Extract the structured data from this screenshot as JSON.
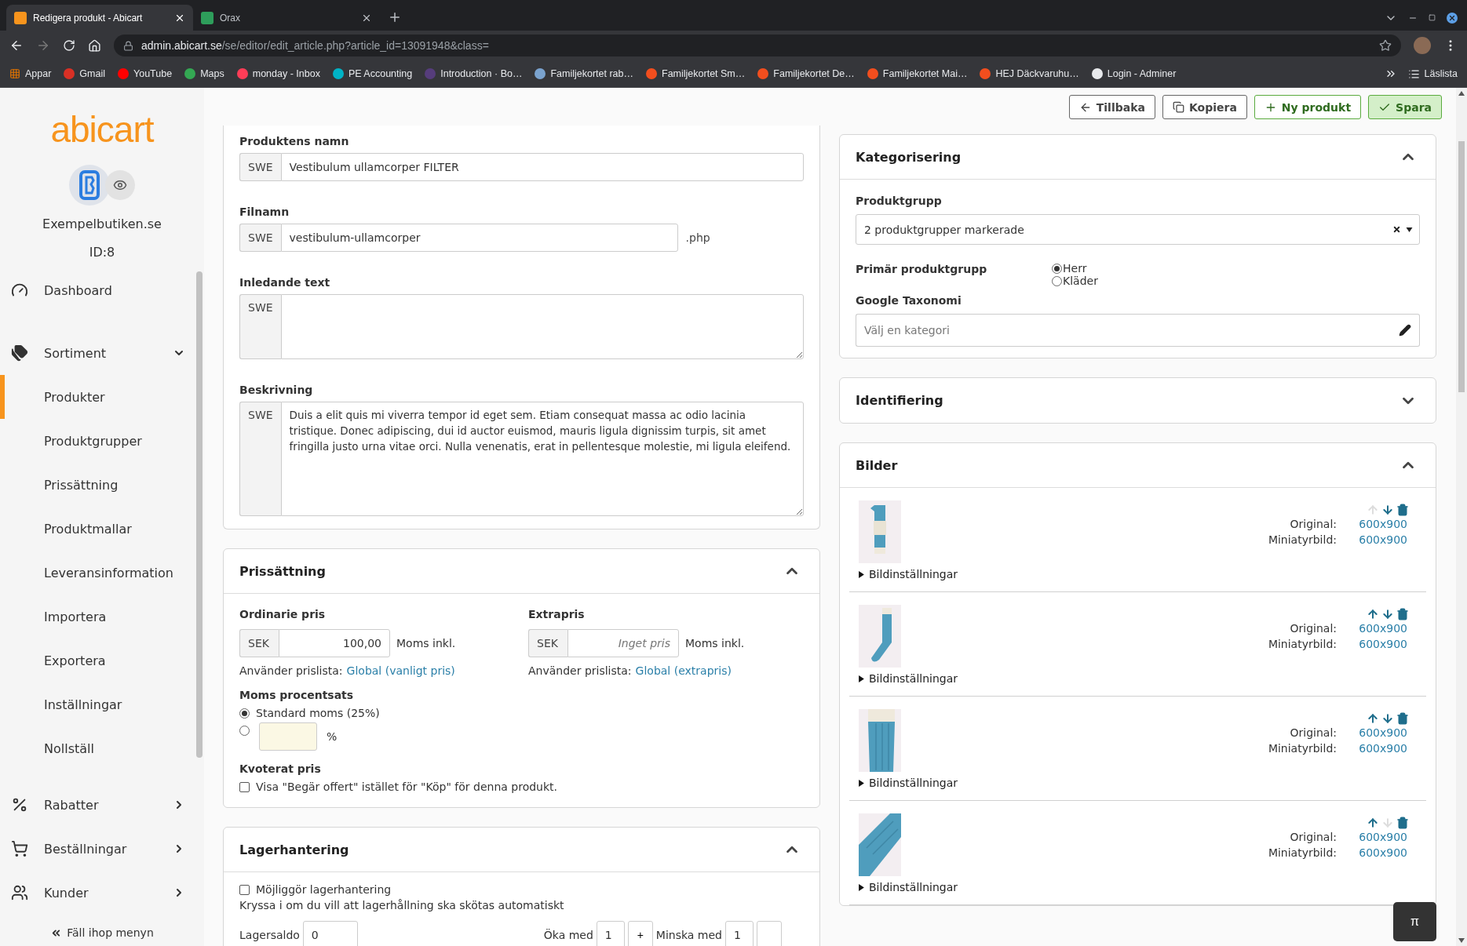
{
  "browser": {
    "tabs": [
      {
        "title": "Redigera produkt - Abicart",
        "selected": true
      },
      {
        "title": "Orax",
        "selected": false
      }
    ],
    "url_host": "admin.abicart.se",
    "url_path": "/se/editor/edit_article.php?article_id=13091948&class=",
    "bookmarks": [
      "Appar",
      "Gmail",
      "YouTube",
      "Maps",
      "monday - Inbox",
      "PE Accounting",
      "Introduction · Bo…",
      "Familjekortet rab…",
      "Familjekortet Sm…",
      "Familjekortet De…",
      "Familjekortet Mai…",
      "HEJ Däckvaruhu…",
      "Login - Adminer"
    ],
    "reading_list": "Läslista"
  },
  "sidebar": {
    "logo": "abicart",
    "shop_name": "Exempelbutiken.se",
    "shop_id": "ID:8",
    "nav": [
      {
        "label": "Dashboard"
      },
      {
        "label": "Sortiment",
        "expanded": true,
        "children": [
          {
            "label": "Produkter",
            "selected": true
          },
          {
            "label": "Produktgrupper",
            "selected": false
          },
          {
            "label": "Prissättning",
            "selected": false
          },
          {
            "label": "Produktmallar",
            "selected": false
          },
          {
            "label": "Leveransinformation",
            "selected": false
          },
          {
            "label": "Importera",
            "selected": false
          },
          {
            "label": "Exportera",
            "selected": false
          },
          {
            "label": "Inställningar",
            "selected": false
          },
          {
            "label": "Nollställ",
            "selected": false
          }
        ]
      },
      {
        "label": "Rabatter",
        "expanded": false
      },
      {
        "label": "Beställningar",
        "expanded": false
      },
      {
        "label": "Kunder",
        "expanded": false
      }
    ],
    "collapse": "Fäll ihop menyn"
  },
  "toolbar": [
    {
      "label": "Tillbaka",
      "kind": "back"
    },
    {
      "label": "Kopiera",
      "kind": "copy"
    },
    {
      "label": "Ny produkt",
      "kind": "new"
    },
    {
      "label": "Spara",
      "kind": "save"
    }
  ],
  "product": {
    "fields": [
      {
        "label": "Produktens namn",
        "kind": "text",
        "prefix": "SWE",
        "value": "Vestibulum ullamcorper FILTER"
      },
      {
        "label": "Filnamn",
        "kind": "text",
        "prefix": "SWE",
        "value": "vestibulum-ullamcorper",
        "suffix": ".php"
      },
      {
        "label": "Inledande text",
        "kind": "textarea",
        "prefix": "SWE"
      },
      {
        "label": "Beskrivning",
        "kind": "textarea",
        "prefix": "SWE",
        "value": "Duis a elit quis mi viverra tempor id eget sem. Etiam consequat massa ac odio lacinia tristique. Donec adipiscing, dui id auctor euismod, mauris ligula dignissim turpis, sit amet fringilla justo urna vitae orci. Nulla venenatis, erat in pellentesque molestie, mi ligula eleifend."
      }
    ]
  },
  "pricing": {
    "title": "Prissättning",
    "expanded": true,
    "prices": [
      {
        "label": "Ordinarie pris",
        "currency": "SEK",
        "value": "100,00",
        "vat_note": "Moms inkl.",
        "pricelist_text": "Använder prislista:",
        "pricelist_link": "Global (vanligt pris)"
      },
      {
        "label": "Extrapris",
        "currency": "SEK",
        "placeholder": "Inget pris",
        "vat_note": "Moms inkl.",
        "pricelist_text": "Använder prislista:",
        "pricelist_link": "Global (extrapris)"
      }
    ],
    "vat_label": "Moms procentsats",
    "vat_options": [
      {
        "kind": "standard",
        "label": "Standard moms (25%)",
        "selected": true
      },
      {
        "kind": "custom",
        "unit": "%",
        "selected": false
      }
    ],
    "quote_label": "Kvoterat pris",
    "quote_option": {
      "label": "Visa \"Begär offert\" istället för \"Köp\" för denna produkt.",
      "checked": false
    }
  },
  "stock": {
    "title": "Lagerhantering",
    "expanded": true,
    "enable": {
      "label": "Möjliggör lagerhantering",
      "checked": false
    },
    "help": "Kryssa i om du vill att lagerhållning ska skötas automatiskt",
    "balance_label": "Lagersaldo",
    "balance": "0",
    "increase_label": "Öka med",
    "increase": "1",
    "increase_button": "+",
    "decrease_label": "Minska med",
    "decrease": "1"
  },
  "categorization": {
    "title": "Kategorisering",
    "expanded": true,
    "group_label": "Produktgrupp",
    "group_value": "2 produktgrupper markerade",
    "primary_label": "Primär produktgrupp",
    "primary_options": [
      {
        "label": "Herr",
        "selected": true
      },
      {
        "label": "Kläder",
        "selected": false
      }
    ],
    "taxonomy_label": "Google Taxonomi",
    "taxonomy_placeholder": "Välj en kategori"
  },
  "identification": {
    "title": "Identifiering",
    "expanded": false
  },
  "images": {
    "title": "Bilder",
    "expanded": true,
    "items": [
      {
        "kind": "picture",
        "settings": "Bildinställningar",
        "original_label": "Original:",
        "original": "600x900",
        "thumb_label": "Miniatyrbild:",
        "thumb": "600x900",
        "up_disabled": true,
        "down_disabled": false
      },
      {
        "kind": "picture",
        "settings": "Bildinställningar",
        "original_label": "Original:",
        "original": "600x900",
        "thumb_label": "Miniatyrbild:",
        "thumb": "600x900",
        "up_disabled": false,
        "down_disabled": false
      },
      {
        "kind": "picture",
        "settings": "Bildinställningar",
        "original_label": "Original:",
        "original": "600x900",
        "thumb_label": "Miniatyrbild:",
        "thumb": "600x900",
        "up_disabled": false,
        "down_disabled": false
      },
      {
        "kind": "picture",
        "settings": "Bildinställningar",
        "original_label": "Original:",
        "original": "600x900",
        "thumb_label": "Miniatyrbild:",
        "thumb": "600x900",
        "up_disabled": false,
        "down_disabled": true
      }
    ]
  },
  "help_button": "π"
}
